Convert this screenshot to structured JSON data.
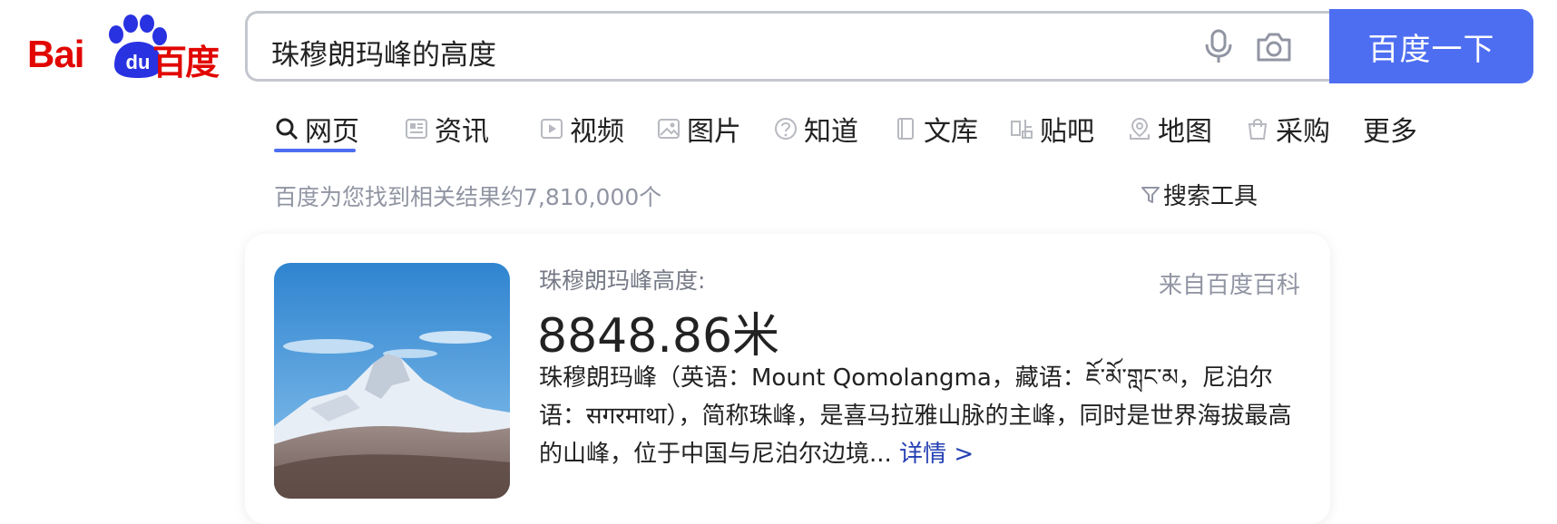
{
  "logo": {
    "text_latin": "Bai",
    "text_du": "du",
    "text_cn": "百度"
  },
  "search": {
    "query": "珠穆朗玛峰的高度",
    "button_label": "百度一下"
  },
  "tabs": [
    {
      "label": "网页",
      "icon": "search-icon"
    },
    {
      "label": "资讯",
      "icon": "news-icon"
    },
    {
      "label": "视频",
      "icon": "video-icon"
    },
    {
      "label": "图片",
      "icon": "image-icon"
    },
    {
      "label": "知道",
      "icon": "question-icon"
    },
    {
      "label": "文库",
      "icon": "doc-icon"
    },
    {
      "label": "贴吧",
      "icon": "tieba-icon"
    },
    {
      "label": "地图",
      "icon": "map-icon"
    },
    {
      "label": "采购",
      "icon": "shopping-bag-icon"
    },
    {
      "label": "更多",
      "icon": ""
    }
  ],
  "results": {
    "count_text": "百度为您找到相关结果约7,810,000个",
    "tools_label": "搜索工具"
  },
  "card": {
    "label": "珠穆朗玛峰高度:",
    "source": "来自百度百科",
    "value": "8848.86米",
    "description": "珠穆朗玛峰（英语：Mount Qomolangma，藏语：ཇོ་མོ་གླང་མ，尼泊尔语：सगरमाथा），简称珠峰，是喜马拉雅山脉的主峰，同时是世界海拔最高的山峰，位于中国与尼泊尔边境...",
    "more_label": "详情 >"
  },
  "colors": {
    "brand_red": "#e10601",
    "brand_blue": "#4e6ef2",
    "link_blue": "#2440b3",
    "muted": "#9195a3"
  }
}
